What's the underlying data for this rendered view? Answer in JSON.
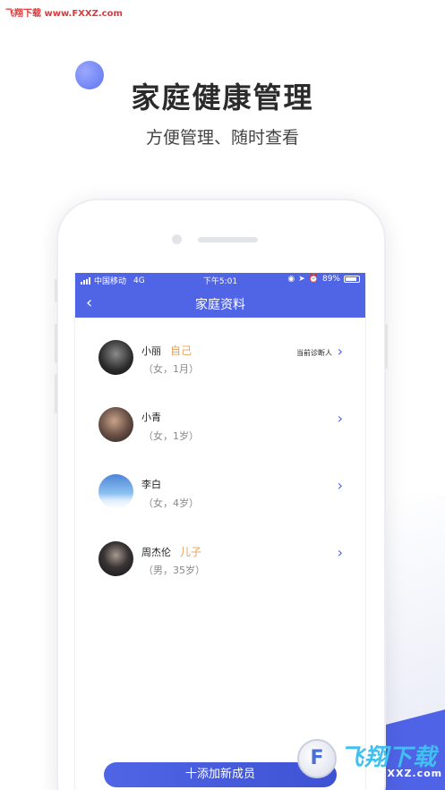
{
  "watermark": {
    "text": "飞翔下载 www.FXXZ.com"
  },
  "promo": {
    "headline": "家庭健康管理",
    "subheadline": "方便管理、随时查看"
  },
  "statusbar": {
    "carrier": "中国移动",
    "network": "4G",
    "time": "下午5:01",
    "battery": "89%",
    "battery_level": 0.89
  },
  "navbar": {
    "back_icon": "‹",
    "title": "家庭资料"
  },
  "members": [
    {
      "name": "小丽",
      "relation": "自己",
      "info": "（女，1月）",
      "status": "当前诊断人",
      "avatar": "avatar-dark-bw"
    },
    {
      "name": "小青",
      "relation": "",
      "info": "（女，1岁）",
      "status": "",
      "avatar": "avatar-portrait"
    },
    {
      "name": "李白",
      "relation": "",
      "info": "（女，4岁）",
      "status": "",
      "avatar": "avatar-balloon-sky"
    },
    {
      "name": "周杰伦",
      "relation": "儿子",
      "info": "（男，35岁）",
      "status": "",
      "avatar": "avatar-woman-dark"
    }
  ],
  "add_button": {
    "label": "十添加新成员"
  },
  "logo": {
    "text": "飞翔下载",
    "url": "www.FXXZ.com",
    "icon": "F"
  },
  "colors": {
    "accent": "#5064e6",
    "relation": "#e8a15c"
  }
}
